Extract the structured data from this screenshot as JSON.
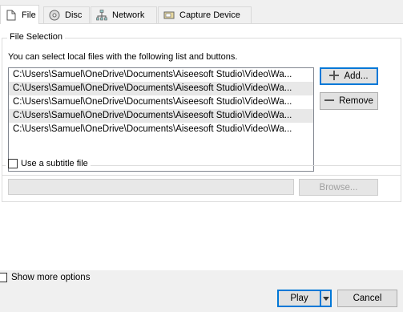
{
  "tabs": [
    {
      "label": "File",
      "icon": "file-icon"
    },
    {
      "label": "Disc",
      "icon": "disc-icon"
    },
    {
      "label": "Network",
      "icon": "network-icon"
    },
    {
      "label": "Capture Device",
      "icon": "capture-device-icon"
    }
  ],
  "file_selection": {
    "title": "File Selection",
    "hint": "You can select local files with the following list and buttons.",
    "files": [
      "C:\\Users\\Samuel\\OneDrive\\Documents\\Aiseesoft Studio\\Video\\Wa...",
      "C:\\Users\\Samuel\\OneDrive\\Documents\\Aiseesoft Studio\\Video\\Wa...",
      "C:\\Users\\Samuel\\OneDrive\\Documents\\Aiseesoft Studio\\Video\\Wa...",
      "C:\\Users\\Samuel\\OneDrive\\Documents\\Aiseesoft Studio\\Video\\Wa...",
      "C:\\Users\\Samuel\\OneDrive\\Documents\\Aiseesoft Studio\\Video\\Wa..."
    ],
    "add_label": "Add...",
    "remove_label": "Remove"
  },
  "subtitle": {
    "checkbox_label": "Use a subtitle file",
    "browse_label": "Browse..."
  },
  "footer": {
    "show_more_label": "Show more options",
    "play_label": "Play",
    "cancel_label": "Cancel"
  }
}
